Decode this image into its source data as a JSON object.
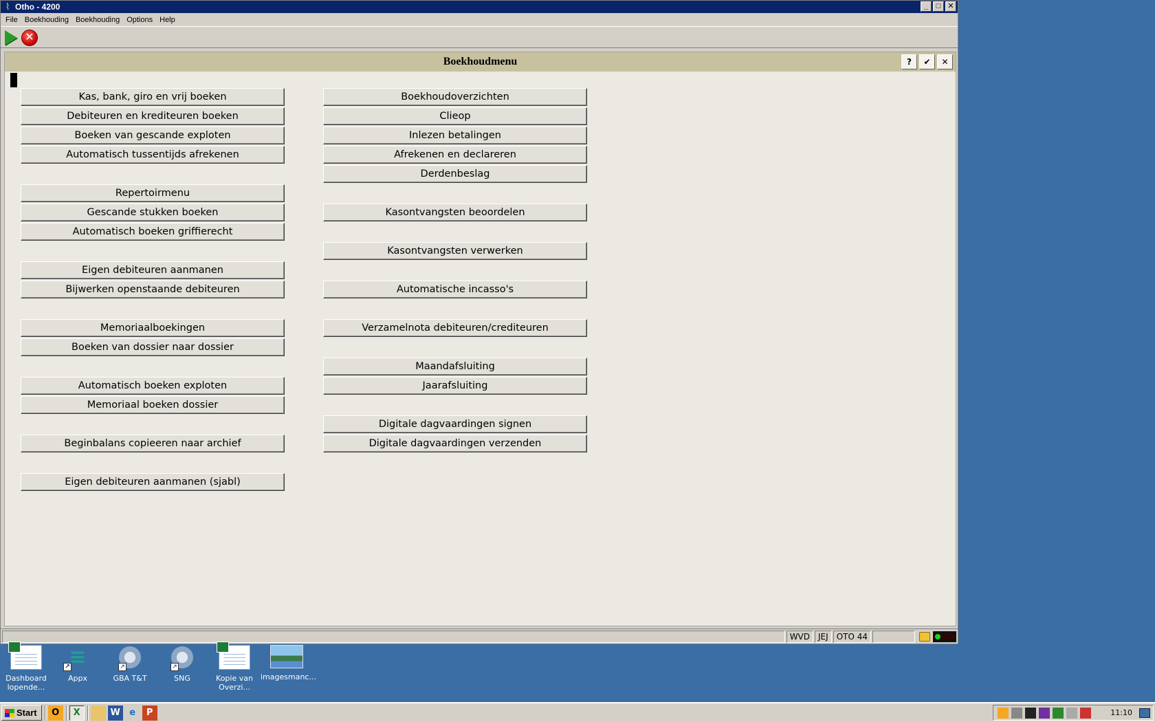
{
  "window": {
    "title": "Otho - 4200",
    "caption_min": "_",
    "caption_max": "□",
    "caption_close": "✕"
  },
  "menu": [
    "File",
    "Boekhouding",
    "Boekhouding",
    "Options",
    "Help"
  ],
  "toolbar": {
    "run_icon": "play-icon",
    "stop_icon": "stop-icon",
    "stop_glyph": "✕"
  },
  "form": {
    "title": "Boekhoudmenu",
    "help_label": "?",
    "ok_label": "✔",
    "close_label": "✕",
    "left_buttons": [
      "Kas, bank, giro en vrij boeken",
      "Debiteuren en krediteuren boeken",
      "Boeken van gescande exploten",
      "Automatisch tussentijds afrekenen",
      "Repertoirmenu",
      "Gescande stukken boeken",
      "Automatisch boeken griffierecht",
      "Eigen debiteuren aanmanen",
      "Bijwerken openstaande debiteuren",
      "Memoriaalboekingen",
      "Boeken van dossier naar dossier",
      "Automatisch boeken exploten",
      "Memoriaal boeken dossier",
      "Beginbalans copieeren naar archief",
      "Eigen debiteuren aanmanen (sjabl)"
    ],
    "right_buttons": [
      "Boekhoudoverzichten",
      "Clieop",
      "Inlezen betalingen",
      "Afrekenen en declareren",
      "Derdenbeslag",
      "Kasontvangsten beoordelen",
      "Kasontvangsten verwerken",
      "Automatische incasso's",
      "Verzamelnota debiteuren/crediteuren",
      "Maandafsluiting",
      "Jaarafsluiting",
      "Digitale dagvaardingen signen",
      "Digitale dagvaardingen verzenden"
    ]
  },
  "status": {
    "cells": [
      "WVD",
      "JEJ",
      "OTO 44",
      ""
    ],
    "lock_icon": "lock-icon",
    "signal_icon": "connection-signal-icon"
  },
  "desktop_icons": [
    {
      "label": "Dashboard lopende...",
      "icon": "spreadsheet-icon"
    },
    {
      "label": "Appx",
      "icon": "appx-icon"
    },
    {
      "label": "GBA T&T",
      "icon": "gear-sheet-icon"
    },
    {
      "label": "SNG",
      "icon": "gear-sheet-icon"
    },
    {
      "label": "Kopie van Overzi...",
      "icon": "spreadsheet-icon"
    },
    {
      "label": "imagesmanc...",
      "icon": "photo-icon"
    }
  ],
  "taskbar": {
    "start_label": "Start",
    "quick_launch": [
      "O",
      "X",
      "",
      "W",
      "e",
      "P"
    ],
    "clock": "11:10"
  }
}
